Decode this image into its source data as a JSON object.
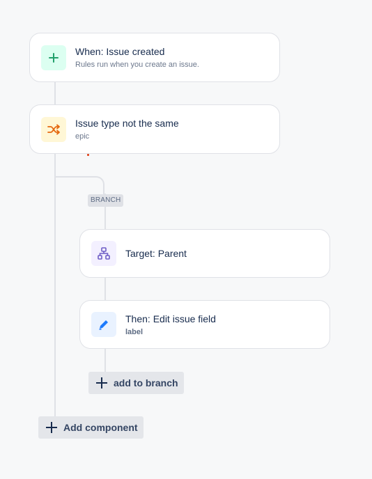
{
  "trigger": {
    "title": "When: Issue created",
    "subtitle": "Rules run when you create an issue.",
    "icon": "plus-icon",
    "icon_bg": "#dcfff1",
    "icon_color": "#22a06b"
  },
  "condition": {
    "title": "Issue type not the same",
    "subtitle": "epic",
    "icon": "shuffle-icon",
    "icon_bg": "#fff7d6",
    "icon_color": "#e56910"
  },
  "branch": {
    "badge": "BRANCH",
    "target": {
      "title": "Target: Parent",
      "icon": "hierarchy-icon",
      "icon_bg": "#f3f0ff",
      "icon_color": "#6e5dc6"
    },
    "action": {
      "title": "Then: Edit issue field",
      "subtitle": "label",
      "icon": "pencil-icon",
      "icon_bg": "#e9f2ff",
      "icon_color": "#1d7afc"
    },
    "add_label": "add to branch"
  },
  "add_component_label": "Add component"
}
